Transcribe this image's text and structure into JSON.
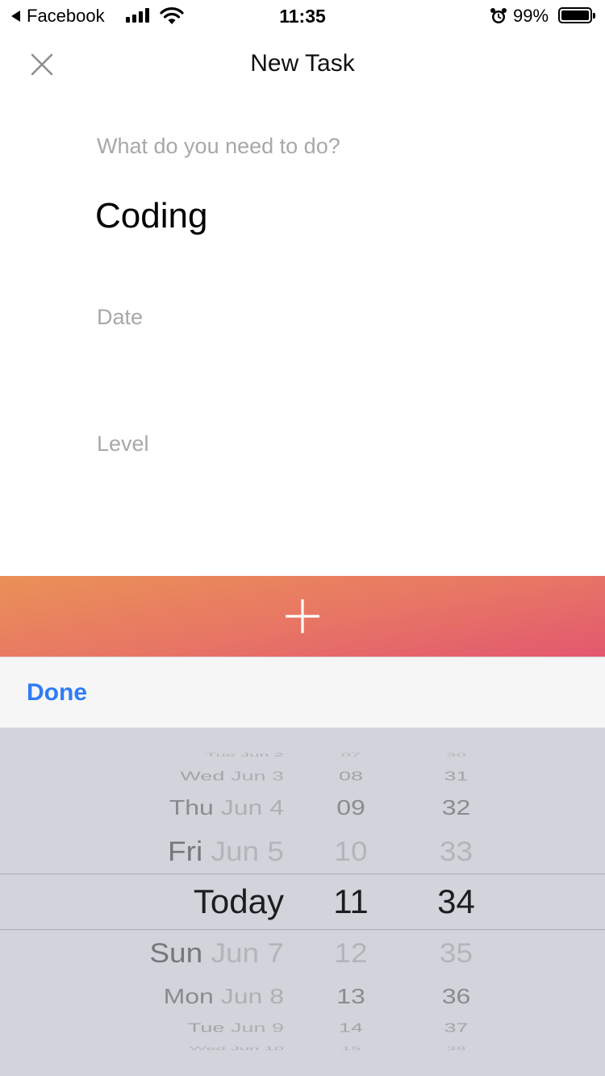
{
  "status_bar": {
    "back_app": "Facebook",
    "time": "11:35",
    "battery": "99%"
  },
  "header": {
    "title": "New Task",
    "close_icon": "close-icon"
  },
  "form": {
    "task_placeholder": "What do you need to do?",
    "task_value": "Coding",
    "date_label": "Date",
    "level_label": "Level"
  },
  "add_bar": {
    "icon": "plus-icon",
    "gradient": [
      "#ea9157",
      "#e3586f"
    ]
  },
  "toolbar": {
    "done_label": "Done",
    "done_color": "#2f7cf6"
  },
  "picker": {
    "rows": [
      {
        "day": "Tue",
        "date": "Jun 2",
        "hour": "07",
        "minute": "30"
      },
      {
        "day": "Wed",
        "date": "Jun 3",
        "hour": "08",
        "minute": "31"
      },
      {
        "day": "Thu",
        "date": "Jun 4",
        "hour": "09",
        "minute": "32"
      },
      {
        "day": "Fri",
        "date": "Jun 5",
        "hour": "10",
        "minute": "33"
      },
      {
        "day": "Today",
        "date": "",
        "hour": "11",
        "minute": "34"
      },
      {
        "day": "Sun",
        "date": "Jun 7",
        "hour": "12",
        "minute": "35"
      },
      {
        "day": "Mon",
        "date": "Jun 8",
        "hour": "13",
        "minute": "36"
      },
      {
        "day": "Tue",
        "date": "Jun 9",
        "hour": "14",
        "minute": "37"
      },
      {
        "day": "Wed",
        "date": "Jun 10",
        "hour": "15",
        "minute": "38"
      }
    ],
    "selected_index": 4
  }
}
